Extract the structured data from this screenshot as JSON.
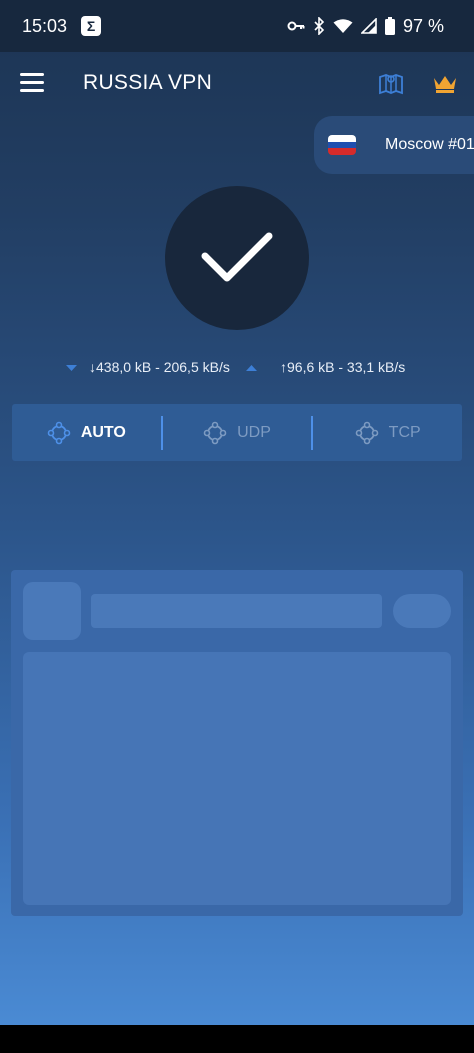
{
  "status_bar": {
    "time": "15:03",
    "notification_glyph": "Σ",
    "icons": [
      "key-icon",
      "bluetooth-icon",
      "wifi-icon",
      "signal-icon",
      "battery-icon"
    ],
    "battery": "97 %"
  },
  "app_bar": {
    "title": "RUSSIA VPN",
    "icons": [
      "menu-icon",
      "map-icon",
      "crown-icon"
    ]
  },
  "server": {
    "name": "Moscow #01",
    "flag_colors": [
      "#ffffff",
      "#1f4fb0",
      "#d62b2b"
    ]
  },
  "connection": {
    "state_icon": "checkmark-icon"
  },
  "traffic": {
    "download": "↓438,0 kB - 206,5 kB/s",
    "upload": "↑96,6 kB - 33,1 kB/s"
  },
  "protocols": [
    {
      "label": "AUTO",
      "active": true
    },
    {
      "label": "UDP",
      "active": false
    },
    {
      "label": "TCP",
      "active": false
    }
  ],
  "colors": {
    "status_bar_bg": "#17283e",
    "circle_bg": "#18273c",
    "protocol_bar_bg": "#2f5c95",
    "divider": "#4e90e8",
    "crown": "#f0a432"
  }
}
